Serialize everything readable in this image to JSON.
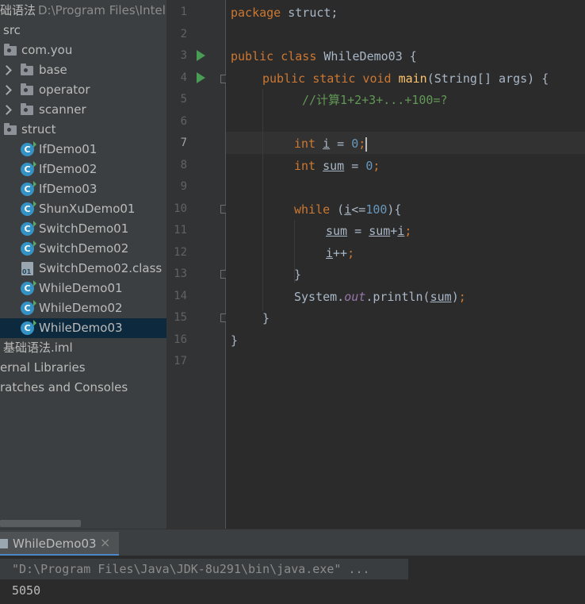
{
  "project": {
    "root_label": "础语法",
    "root_path": "D:\\Program Files\\Intell",
    "items": [
      {
        "label": "src"
      },
      {
        "label": "com.you"
      },
      {
        "label": "base"
      },
      {
        "label": "operator"
      },
      {
        "label": "scanner"
      },
      {
        "label": "struct"
      },
      {
        "label": "IfDemo01"
      },
      {
        "label": "IfDemo02"
      },
      {
        "label": "IfDemo03"
      },
      {
        "label": "ShunXuDemo01"
      },
      {
        "label": "SwitchDemo01"
      },
      {
        "label": "SwitchDemo02"
      },
      {
        "label": "SwitchDemo02.class"
      },
      {
        "label": "WhileDemo01"
      },
      {
        "label": "WhileDemo02"
      },
      {
        "label": "WhileDemo03"
      },
      {
        "label": "基础语法.iml"
      },
      {
        "label": "ernal Libraries"
      },
      {
        "label": "ratches and Consoles"
      }
    ]
  },
  "editor": {
    "line_numbers": [
      "1",
      "2",
      "3",
      "4",
      "5",
      "6",
      "7",
      "8",
      "9",
      "10",
      "11",
      "12",
      "13",
      "14",
      "15",
      "16",
      "17"
    ],
    "current_line": "7",
    "code": {
      "l1_kw": "package",
      "l1_rest": " struct;",
      "l3_kw": "public class",
      "l3_rest": " WhileDemo03 {",
      "l4_kw": "public static void",
      "l4_fn": "main",
      "l4_rest": "(String[] args) {",
      "l5_comment": "//计算1+2+3+...+100=?",
      "l7_kw": "int",
      "l7_var": "i",
      "l7_eq": " = ",
      "l7_num": "0",
      "l7_semi": ";",
      "l8_kw": "int",
      "l8_var": "sum",
      "l8_eq": " = ",
      "l8_num": "0",
      "l8_semi": ";",
      "l10_kw": "while",
      "l10_open": " (",
      "l10_var": "i",
      "l10_op": "<=",
      "l10_num": "100",
      "l10_close": "){",
      "l11_var1": "sum",
      "l11_eq": " = ",
      "l11_var2": "sum",
      "l11_plus": "+",
      "l11_var3": "i",
      "l11_semi": ";",
      "l12_var": "i",
      "l12_inc": "++",
      "l12_semi": ";",
      "l13": "}",
      "l14_sys": "System.",
      "l14_out": "out",
      "l14_println": ".println(",
      "l14_var": "sum",
      "l14_close": ")",
      "l14_semi": ";",
      "l15": "}",
      "l16": "}"
    }
  },
  "run": {
    "tab_label": "WhileDemo03",
    "close_label": "×",
    "command": "\"D:\\Program Files\\Java\\JDK-8u291\\bin\\java.exe\" ...",
    "output": "5050"
  },
  "colors": {
    "keyword": "#cc7832",
    "function": "#ffc66d",
    "number": "#6897bb",
    "comment": "#629755",
    "static_field": "#9876aa",
    "run_icon": "#499c54",
    "class_icon": "#3592c4",
    "selection": "#0d293e"
  },
  "icons": {
    "folder": "folder-icon",
    "package": "package-icon",
    "class": "java-class-icon",
    "class_file": "class-file-icon",
    "run": "run-gutter-icon",
    "fold": "fold-marker-icon"
  }
}
